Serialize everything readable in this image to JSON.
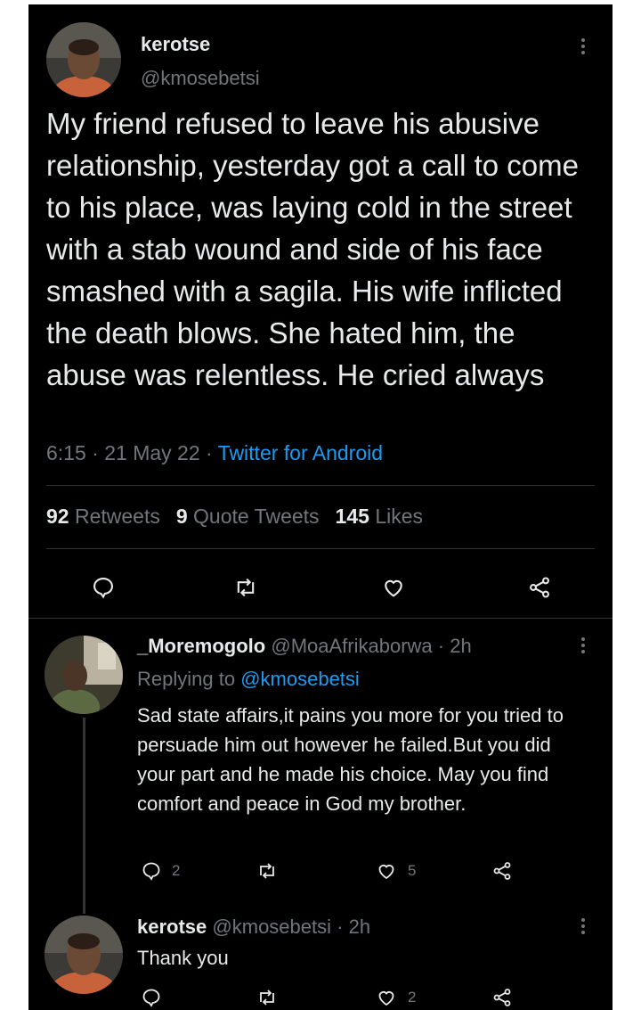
{
  "main_tweet": {
    "display_name": "kerotse",
    "handle": "@kmosebetsi",
    "text": "My friend refused to leave his abusive relationship, yesterday got a call to come to his place, was laying cold in the street with a stab wound and side of his face smashed with a sagila. His wife inflicted the death blows. She hated him, the abuse was relentless. He cried always",
    "time": "6:15",
    "separator": "·",
    "date": "21 May 22",
    "source": "Twitter for Android",
    "stats": {
      "retweets_count": "92",
      "retweets_label": "Retweets",
      "quotes_count": "9",
      "quotes_label": "Quote Tweets",
      "likes_count": "145",
      "likes_label": "Likes"
    }
  },
  "replies": [
    {
      "display_name": "_Moremogolo",
      "handle": "@MoaAfrikaborwa",
      "time": "· 2h",
      "replying_prefix": "Replying to",
      "replying_to": "@kmosebetsi",
      "text": "Sad state affairs,it pains you more for you tried to persuade him out however he failed.But you did your part and he made his choice. May you find comfort and peace in God my brother.",
      "reply_count": "2",
      "retweet_count": "",
      "like_count": "5"
    },
    {
      "display_name": "kerotse",
      "handle": "@kmosebetsi",
      "time": "· 2h",
      "text": "Thank you",
      "reply_count": "",
      "retweet_count": "",
      "like_count": "2"
    }
  ],
  "colors": {
    "background": "#000000",
    "text": "#e7e9ea",
    "secondary": "#71767b",
    "link": "#1d9bf0",
    "divider": "#2f3336"
  }
}
